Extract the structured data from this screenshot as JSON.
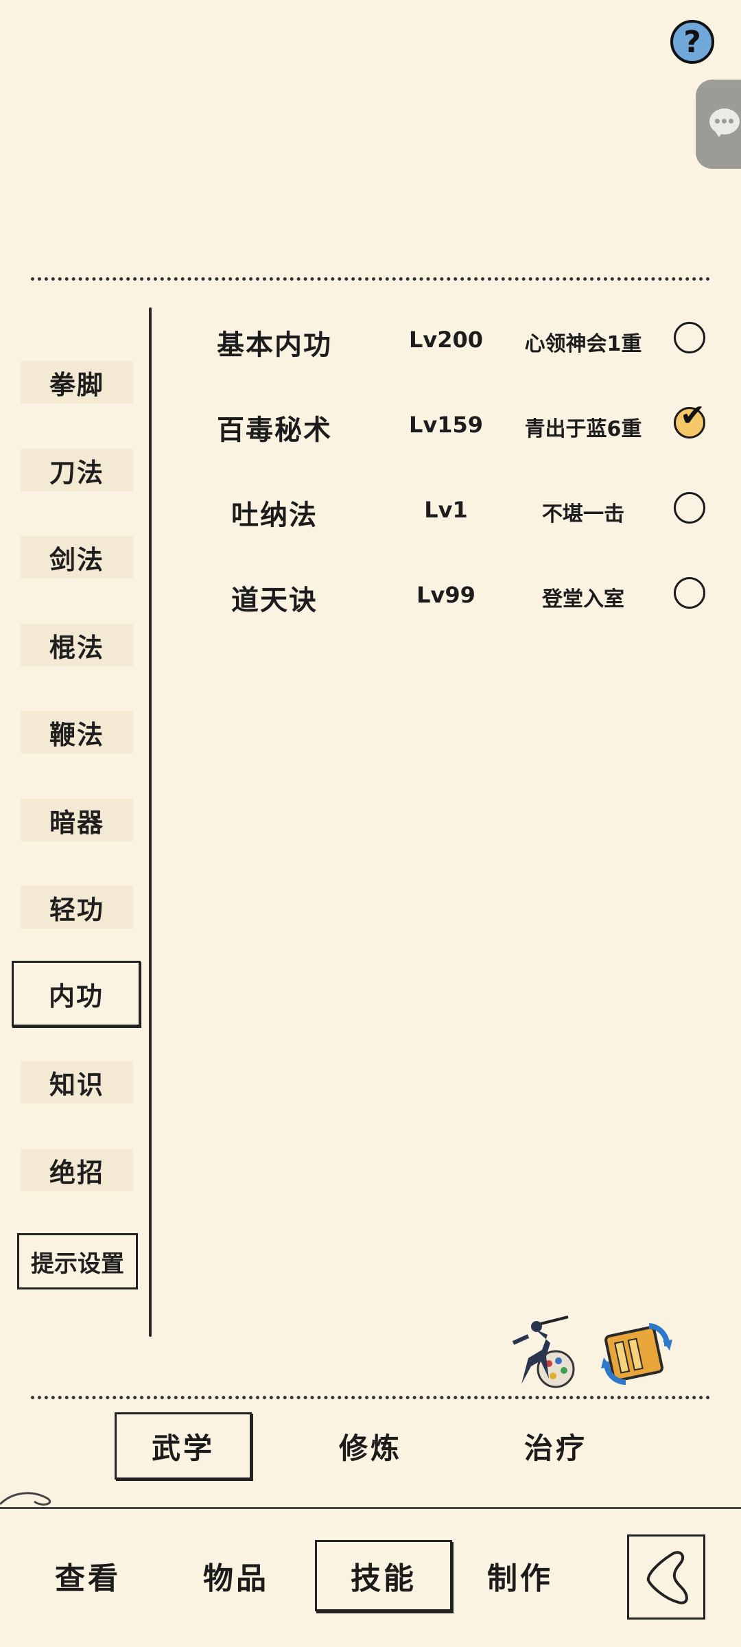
{
  "header": {
    "help_label": "?",
    "help_icon": "question-mark-icon",
    "chat_icon": "chat-bubble-icon"
  },
  "categories": [
    {
      "label": "拳脚"
    },
    {
      "label": "刀法"
    },
    {
      "label": "剑法"
    },
    {
      "label": "棍法"
    },
    {
      "label": "鞭法"
    },
    {
      "label": "暗器"
    },
    {
      "label": "轻功"
    },
    {
      "label": "内功"
    },
    {
      "label": "知识"
    },
    {
      "label": "绝招"
    }
  ],
  "active_category": "内功",
  "hint_settings_label": "提示设置",
  "skills": [
    {
      "name": "基本内功",
      "level": "Lv200",
      "rank": "心领神会1重",
      "checked": false
    },
    {
      "name": "百毒秘术",
      "level": "Lv159",
      "rank": "青出于蓝6重",
      "checked": true
    },
    {
      "name": "吐纳法",
      "level": "Lv1",
      "rank": "不堪一击",
      "checked": false
    },
    {
      "name": "道天诀",
      "level": "Lv99",
      "rank": "登堂入室",
      "checked": false
    }
  ],
  "check_mark": "✔",
  "action_icons": [
    "ninja-paint-icon",
    "scroll-swap-icon"
  ],
  "subtabs": [
    {
      "label": "武学",
      "active": true
    },
    {
      "label": "修炼",
      "active": false
    },
    {
      "label": "治疗",
      "active": false
    }
  ],
  "bottom_nav": [
    {
      "label": "查看",
      "active": false
    },
    {
      "label": "物品",
      "active": false
    },
    {
      "label": "技能",
      "active": true
    },
    {
      "label": "制作",
      "active": false
    }
  ],
  "back_icon": "back-chevron-icon"
}
